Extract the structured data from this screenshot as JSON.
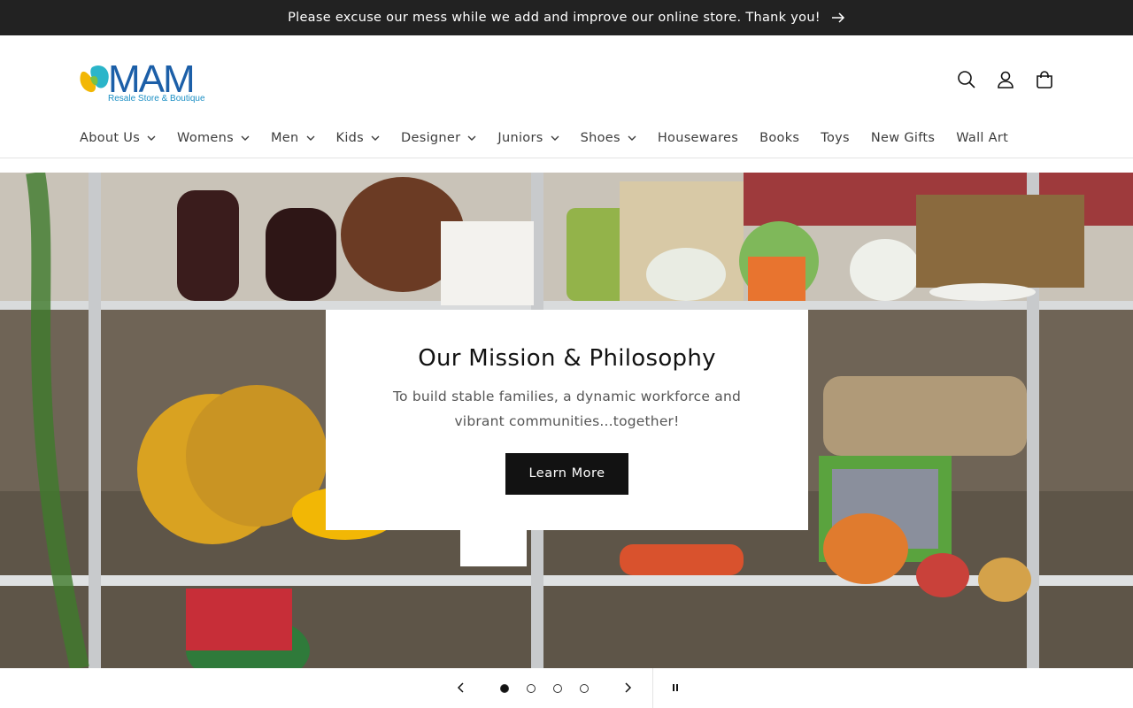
{
  "announcement": {
    "text": "Please excuse our mess while we add and improve our online store. Thank you!"
  },
  "logo": {
    "wordmark": "MAM",
    "tagline": "Resale Store & Boutique"
  },
  "header_icons": [
    "search-icon",
    "account-icon",
    "cart-icon"
  ],
  "nav": {
    "items": [
      {
        "label": "About Us",
        "dropdown": true
      },
      {
        "label": "Womens",
        "dropdown": true
      },
      {
        "label": "Men",
        "dropdown": true
      },
      {
        "label": "Kids",
        "dropdown": true
      },
      {
        "label": "Designer",
        "dropdown": true
      },
      {
        "label": "Juniors",
        "dropdown": true
      },
      {
        "label": "Shoes",
        "dropdown": true
      },
      {
        "label": "Housewares",
        "dropdown": false
      },
      {
        "label": "Books",
        "dropdown": false
      },
      {
        "label": "Toys",
        "dropdown": false
      },
      {
        "label": "New Gifts",
        "dropdown": false
      },
      {
        "label": "Wall Art",
        "dropdown": false
      }
    ]
  },
  "hero": {
    "title": "Our Mission & Philosophy",
    "text": "To build stable families, a dynamic workforce and vibrant communities...together!",
    "button": "Learn More"
  },
  "slider": {
    "slide_count": 4,
    "active_slide": 1
  },
  "colors": {
    "announcement_bg": "#222222",
    "button_bg": "#121212",
    "logo_blue": "#1c5fa8",
    "logo_yellow": "#f2b705",
    "logo_teal": "#2bb5c9"
  }
}
